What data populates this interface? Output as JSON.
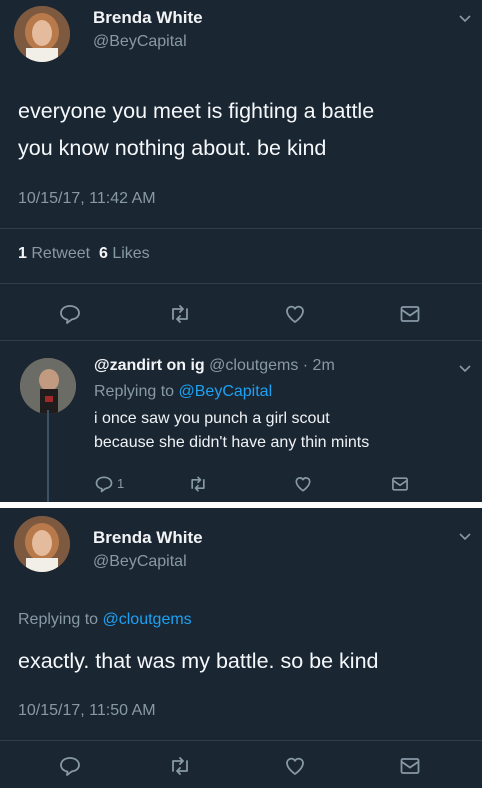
{
  "tweet1": {
    "author_name": "Brenda White",
    "author_handle": "@BeyCapital",
    "text_line1": "everyone you meet is fighting a battle",
    "text_line2": "you know nothing about. be kind",
    "timestamp": "10/15/17, 11:42 AM",
    "retweet_count": "1",
    "retweet_label": "Retweet",
    "like_count": "6",
    "like_label": "Likes"
  },
  "reply": {
    "author_name": "@zandirt on ig",
    "author_handle": "@cloutgems",
    "time_ago": "· 2m",
    "replying_prefix": "Replying to",
    "replying_to": "@BeyCapital",
    "text_line1": "i once saw you punch a girl scout",
    "text_line2": "because she didn't have any thin mints",
    "reply_count": "1"
  },
  "tweet2": {
    "author_name": "Brenda White",
    "author_handle": "@BeyCapital",
    "replying_prefix": "Replying to",
    "replying_to": "@cloutgems",
    "text": "exactly. that was my battle. so be kind",
    "timestamp": "10/15/17, 11:50 AM"
  },
  "icons": [
    "chevron-down-icon",
    "reply-icon",
    "retweet-icon",
    "like-icon",
    "dm-icon"
  ],
  "colors": {
    "background": "#1b2633",
    "link": "#1da1f2",
    "muted": "#8899a6"
  }
}
